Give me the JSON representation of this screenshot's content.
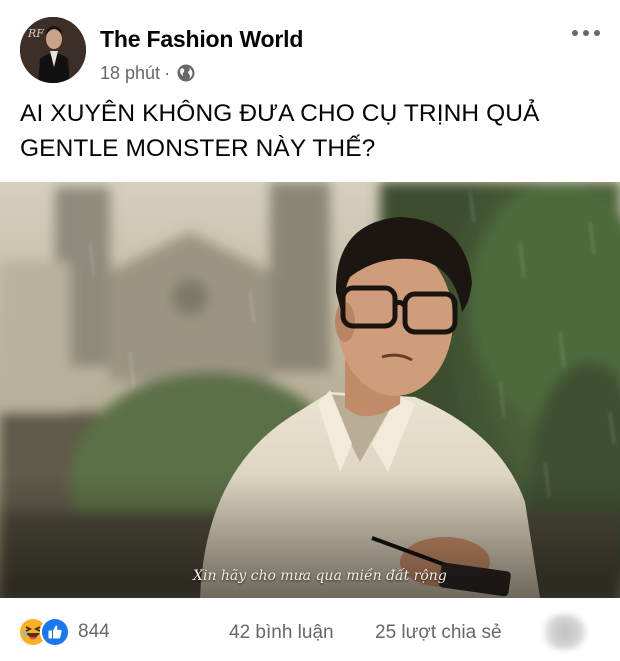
{
  "post": {
    "page_name": "The Fashion World",
    "time": "18 phút",
    "separator": "·",
    "privacy_icon": "globe-icon",
    "more_icon": "more-horizontal-icon",
    "caption_lines": [
      "AI XUYÊN KHÔNG ĐƯA CHO CỤ TRỊNH QUẢ",
      "GENTLE MONSTER NÀY THẾ?"
    ]
  },
  "photo": {
    "subtitle": "Xin hãy cho mưa qua miền đất rộng"
  },
  "footer": {
    "reaction_icons": [
      "haha-reaction-icon",
      "like-reaction-icon"
    ],
    "reaction_count": "844",
    "comments": "42 bình luận",
    "shares": "25 lượt chia sẻ"
  },
  "colors": {
    "text_primary": "#050505",
    "text_secondary": "#65676b",
    "like_blue": "#1877f2",
    "haha_yellow": "#f7b125"
  }
}
